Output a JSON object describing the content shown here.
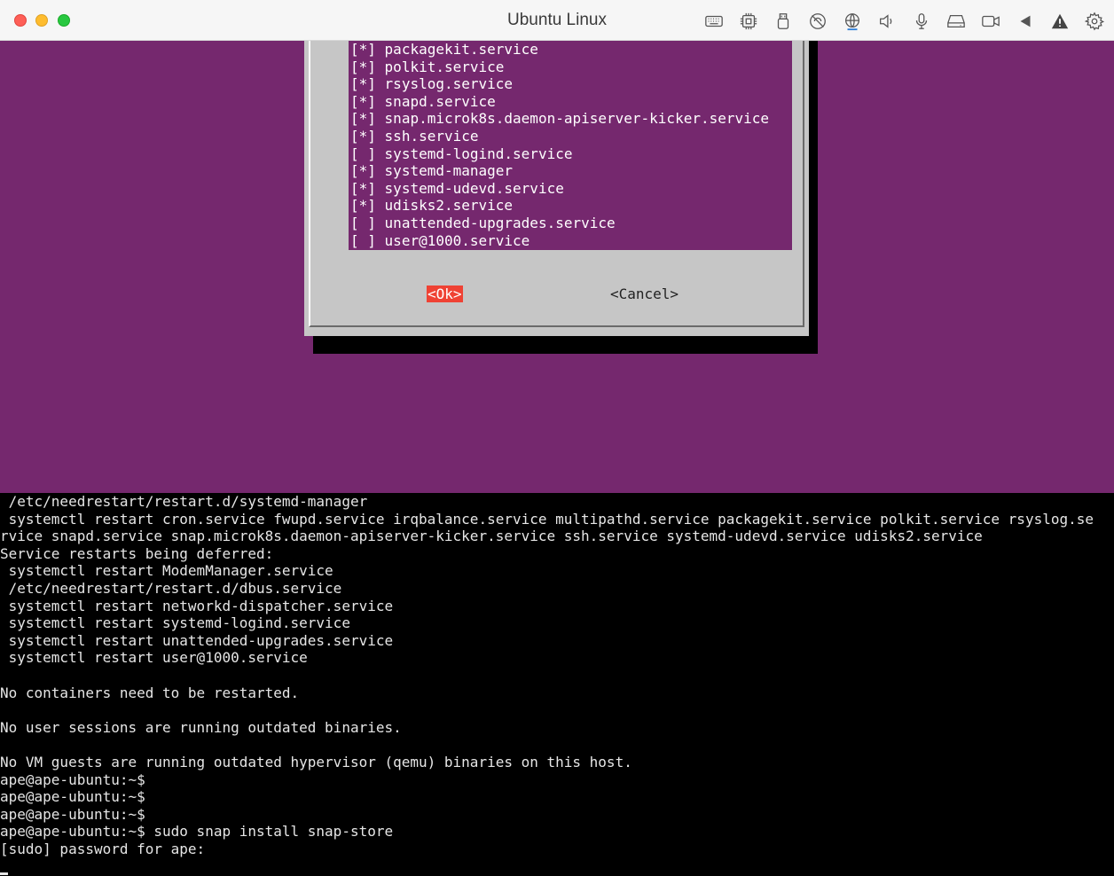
{
  "window": {
    "title": "Ubuntu Linux",
    "toolbar_icons": [
      "keyboard-icon",
      "cpu-icon",
      "usb-icon",
      "network-disabled-icon",
      "globe-icon",
      "speaker-icon",
      "microphone-icon",
      "disk-icon",
      "camera-icon",
      "play-back-icon",
      "warning-icon",
      "gear-icon"
    ]
  },
  "dialog": {
    "items": [
      {
        "mark": "[*]",
        "label": "packagekit.service"
      },
      {
        "mark": "[*]",
        "label": "polkit.service"
      },
      {
        "mark": "[*]",
        "label": "rsyslog.service"
      },
      {
        "mark": "[*]",
        "label": "snapd.service"
      },
      {
        "mark": "[*]",
        "label": "snap.microk8s.daemon-apiserver-kicker.service"
      },
      {
        "mark": "[*]",
        "label": "ssh.service"
      },
      {
        "mark": "[ ]",
        "label": "systemd-logind.service"
      },
      {
        "mark": "[*]",
        "label": "systemd-manager"
      },
      {
        "mark": "[*]",
        "label": "systemd-udevd.service"
      },
      {
        "mark": "[*]",
        "label": "udisks2.service"
      },
      {
        "mark": "[ ]",
        "label": "unattended-upgrades.service"
      },
      {
        "mark": "[ ]",
        "label": "user@1000.service"
      }
    ],
    "ok_label": "<Ok>",
    "cancel_label": "<Cancel>"
  },
  "terminal": {
    "lines": [
      " /etc/needrestart/restart.d/systemd-manager",
      " systemctl restart cron.service fwupd.service irqbalance.service multipathd.service packagekit.service polkit.service rsyslog.se",
      "rvice snapd.service snap.microk8s.daemon-apiserver-kicker.service ssh.service systemd-udevd.service udisks2.service",
      "Service restarts being deferred:",
      " systemctl restart ModemManager.service",
      " /etc/needrestart/restart.d/dbus.service",
      " systemctl restart networkd-dispatcher.service",
      " systemctl restart systemd-logind.service",
      " systemctl restart unattended-upgrades.service",
      " systemctl restart user@1000.service",
      "",
      "No containers need to be restarted.",
      "",
      "No user sessions are running outdated binaries.",
      "",
      "No VM guests are running outdated hypervisor (qemu) binaries on this host.",
      "ape@ape-ubuntu:~$",
      "ape@ape-ubuntu:~$",
      "ape@ape-ubuntu:~$",
      "ape@ape-ubuntu:~$ sudo snap install snap-store",
      "[sudo] password for ape:"
    ]
  },
  "colors": {
    "purple_bg": "#75286e",
    "dialog_bg": "#c6c6c6",
    "ok_highlight": "#ef4234"
  }
}
